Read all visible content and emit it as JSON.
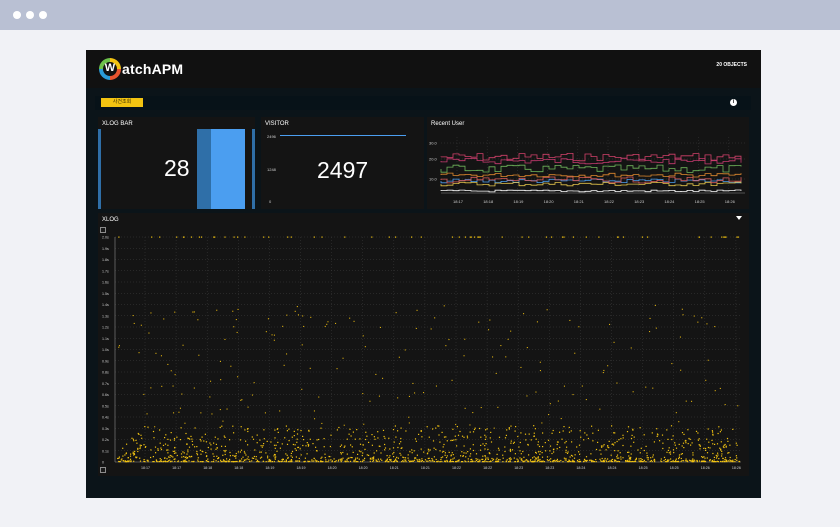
{
  "app": {
    "brand_letter": "W",
    "brand_rest": "atchAPM",
    "objects": "20 OBJECTS"
  },
  "filter": {
    "button_label": "사건조회"
  },
  "xlog_bar": {
    "title": "XLOG BAR",
    "value": "28"
  },
  "visitor": {
    "title": "VISITOR",
    "value": "2497",
    "y_ticks": [
      "2496",
      "1248",
      "0"
    ]
  },
  "recent_user": {
    "title": "Recent User",
    "y_ticks": [
      "30.0",
      "20.0",
      "10.0"
    ],
    "x_ticks": [
      "18:17",
      "18:18",
      "18:19",
      "18:20",
      "18:21",
      "18:22",
      "18:23",
      "18:24",
      "18:25",
      "18:26"
    ]
  },
  "xlog": {
    "title": "XLOG",
    "y_ticks": [
      "2.0s",
      "1.9s",
      "1.8s",
      "1.7s",
      "1.6s",
      "1.5s",
      "1.4s",
      "1.3s",
      "1.2s",
      "1.1s",
      "1.0s",
      "0.9s",
      "0.8s",
      "0.7s",
      "0.6s",
      "0.5s",
      "0.4s",
      "0.3s",
      "0.2s",
      "0.1s",
      "0"
    ],
    "x_ticks": [
      "18:17",
      "18:17",
      "18:18",
      "18:18",
      "18:19",
      "18:19",
      "18:20",
      "18:20",
      "18:21",
      "18:21",
      "18:22",
      "18:22",
      "18:23",
      "18:23",
      "18:24",
      "18:24",
      "18:25",
      "18:25",
      "18:26",
      "18:26"
    ]
  },
  "colors": {
    "accent": "#f2c311",
    "bar_blue": "#4b9ef0",
    "bar_dark": "#2f6fa8",
    "panel": "#141414",
    "background": "#0b1419"
  }
}
